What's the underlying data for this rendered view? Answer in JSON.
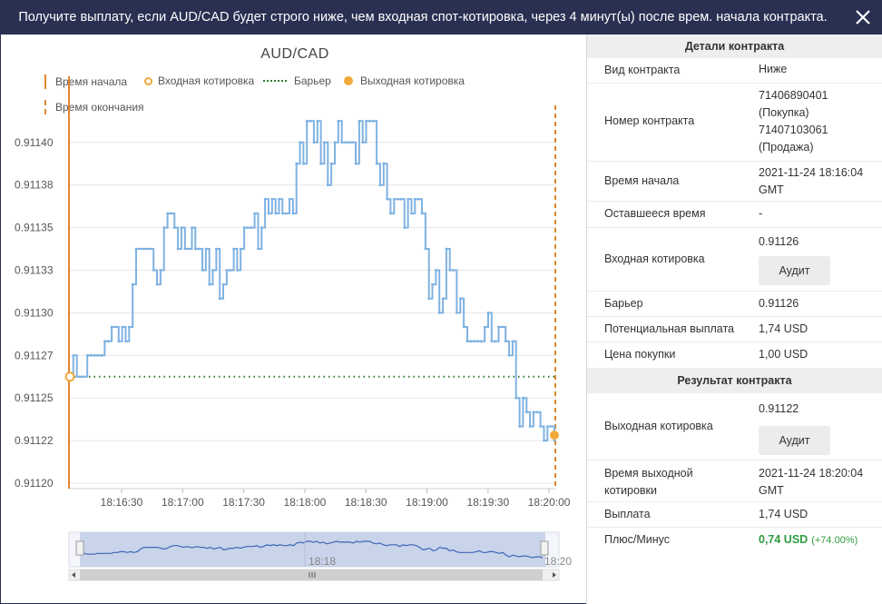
{
  "header": {
    "title": "Получите выплату, если AUD/CAD будет строго ниже, чем входная спот-котировка, через 4 минут(ы) после врем. начала контракта.",
    "close_icon": "close-icon"
  },
  "chart": {
    "title": "AUD/CAD",
    "legend": {
      "start_time": "Время начала",
      "entry_spot": "Входная котировка",
      "barrier": "Барьер",
      "exit_spot": "Выходная котировка",
      "end_time": "Время окончания"
    },
    "navigator_label_mid": "18:18",
    "navigator_label_end": "18:20"
  },
  "chart_data": {
    "type": "line",
    "title": "AUD/CAD",
    "x_tick_labels": [
      "18:16:30",
      "18:17:00",
      "18:17:30",
      "18:18:00",
      "18:18:30",
      "18:19:00",
      "18:19:30",
      "18:20:00"
    ],
    "y_tick_labels": [
      "0.91120",
      "0.91122",
      "0.91125",
      "0.91127",
      "0.91130",
      "0.91133",
      "0.91135",
      "0.91138",
      "0.91140"
    ],
    "ylim": [
      0.9112,
      0.91142
    ],
    "start_time": "18:16:04",
    "end_time": "18:20:04",
    "entry_spot": 0.91126,
    "barrier": 0.91126,
    "exit_spot": 0.91122,
    "series": [
      {
        "values": [
          0.91126,
          0.91127,
          0.91126,
          0.91126,
          0.91126,
          0.91127,
          0.91127,
          0.91127,
          0.91127,
          0.91127,
          0.91128,
          0.91128,
          0.91129,
          0.91129,
          0.91128,
          0.91129,
          0.91128,
          0.91129,
          0.91132,
          0.91134,
          0.91134,
          0.91134,
          0.91134,
          0.91134,
          0.91133,
          0.91132,
          0.91133,
          0.91135,
          0.91136,
          0.91136,
          0.91135,
          0.91134,
          0.91135,
          0.91134,
          0.91134,
          0.91135,
          0.91134,
          0.91134,
          0.91133,
          0.91134,
          0.91132,
          0.91133,
          0.91134,
          0.91131,
          0.91132,
          0.91133,
          0.91133,
          0.91134,
          0.91133,
          0.91134,
          0.91135,
          0.91135,
          0.91135,
          0.91136,
          0.91134,
          0.91135,
          0.91137,
          0.91136,
          0.91137,
          0.91136,
          0.91137,
          0.91136,
          0.91136,
          0.91137,
          0.91136,
          0.91139,
          0.9114,
          0.91139,
          0.91141,
          0.91141,
          0.9114,
          0.91141,
          0.91139,
          0.9114,
          0.91138,
          0.91139,
          0.9114,
          0.91141,
          0.9114,
          0.9114,
          0.9114,
          0.9114,
          0.91139,
          0.91141,
          0.9114,
          0.91141,
          0.91141,
          0.91141,
          0.91139,
          0.91138,
          0.91139,
          0.91137,
          0.91136,
          0.91137,
          0.91137,
          0.91137,
          0.91135,
          0.91137,
          0.91136,
          0.91137,
          0.91137,
          0.91136,
          0.91134,
          0.91131,
          0.91132,
          0.91133,
          0.9113,
          0.91131,
          0.91134,
          0.91133,
          0.91133,
          0.9113,
          0.91131,
          0.91129,
          0.91128,
          0.91128,
          0.91128,
          0.91128,
          0.91128,
          0.91129,
          0.9113,
          0.91128,
          0.91128,
          0.91129,
          0.91129,
          0.91128,
          0.91127,
          0.91128,
          0.91125,
          0.91123,
          0.91125,
          0.91124,
          0.91123,
          0.91124,
          0.91124,
          0.91123,
          0.91122,
          0.91123,
          0.91123,
          0.91122
        ]
      }
    ]
  },
  "details": {
    "section_title": "Детали контракта",
    "contract_type_label": "Вид контракта",
    "contract_type_value": "Ниже",
    "contract_no_label": "Номер контракта",
    "contract_no_line1": "71406890401",
    "contract_no_line2": "(Покупка)",
    "contract_no_line3": "71407103061",
    "contract_no_line4": "(Продажа)",
    "start_time_label": "Время начала",
    "start_time_line1": "2021-11-24 18:16:04",
    "start_time_line2": "GMT",
    "remaining_label": "Оставшееся время",
    "remaining_value": "-",
    "entry_spot_label": "Входная котировка",
    "entry_spot_value": "0.91126",
    "audit_label": "Аудит",
    "barrier_label": "Барьер",
    "barrier_value": "0.91126",
    "payout_label": "Потенциальная выплата",
    "payout_value": "1,74 USD",
    "price_label": "Цена покупки",
    "price_value": "1,00 USD"
  },
  "result": {
    "section_title": "Результат контракта",
    "exit_spot_label": "Выходная котировка",
    "exit_spot_value": "0.91122",
    "audit_label": "Аудит",
    "exit_time_label_line1": "Время выходной",
    "exit_time_label_line2": "котировки",
    "exit_time_line1": "2021-11-24 18:20:04",
    "exit_time_line2": "GMT",
    "payout_label": "Выплата",
    "payout_value": "1,74 USD",
    "pl_label": "Плюс/Минус",
    "pl_value": "0,74 USD",
    "pl_pct": "(+74.00%)"
  }
}
